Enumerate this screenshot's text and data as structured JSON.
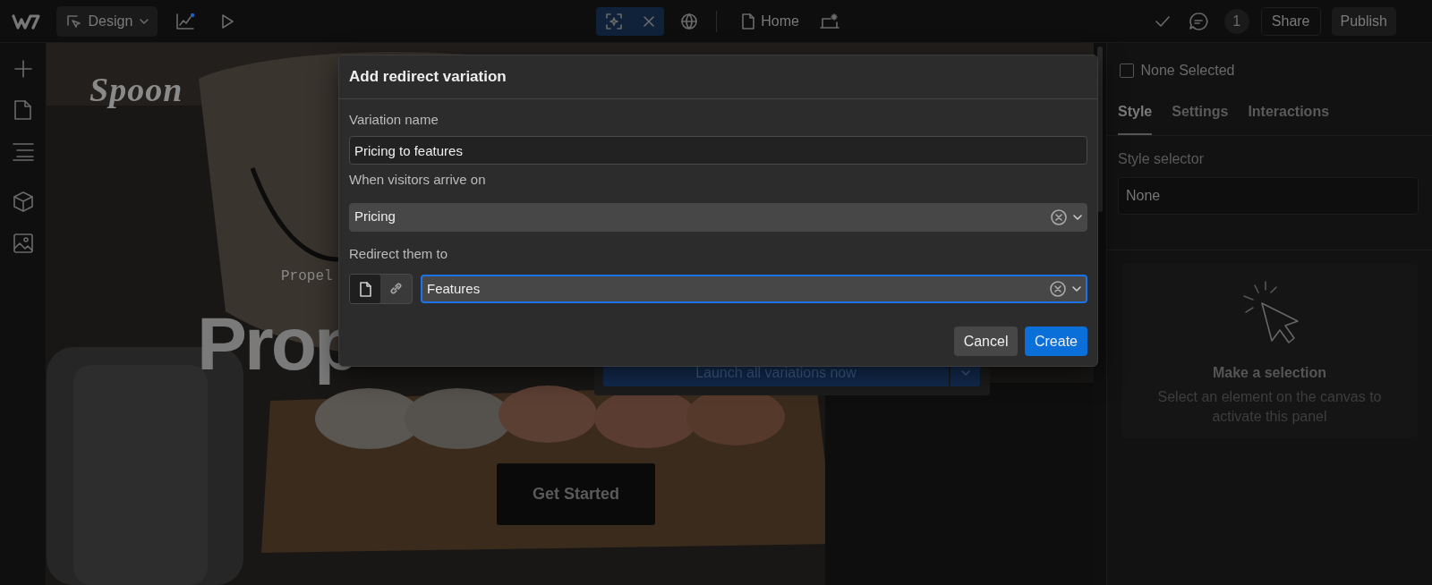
{
  "topbar": {
    "mode_button": "Design",
    "page": "Home",
    "comment_count": "1",
    "share": "Share",
    "publish": "Publish"
  },
  "canvas": {
    "logo": "Spoon",
    "eyebrow": "Propel",
    "headline": "Prop",
    "launch_button": "Launch all variations now",
    "cta": "Get Started"
  },
  "modal": {
    "title": "Add redirect variation",
    "fields": [
      {
        "kind": "text",
        "label": "Variation name",
        "value": "Pricing to features"
      },
      {
        "kind": "select",
        "label": "When visitors arrive on",
        "value": "Pricing",
        "focused": false
      },
      {
        "kind": "target",
        "label": "Redirect them to",
        "value": "Features",
        "focused": true,
        "targets": [
          {
            "kind": "page",
            "selected": true
          },
          {
            "kind": "link",
            "selected": false
          }
        ]
      }
    ],
    "buttons": [
      {
        "label": "Cancel",
        "kind": "secondary"
      },
      {
        "label": "Create",
        "kind": "primary"
      }
    ]
  },
  "panel": {
    "selection": {
      "label": "None Selected",
      "checked": false
    },
    "tabs": [
      {
        "label": "Style",
        "selected": true
      },
      {
        "label": "Settings",
        "selected": false
      },
      {
        "label": "Interactions",
        "selected": false
      }
    ],
    "selector_label": "Style selector",
    "selector_placeholder": "None",
    "empty_title": "Make a selection",
    "empty_text": "Select an element on the canvas to activate this panel"
  }
}
